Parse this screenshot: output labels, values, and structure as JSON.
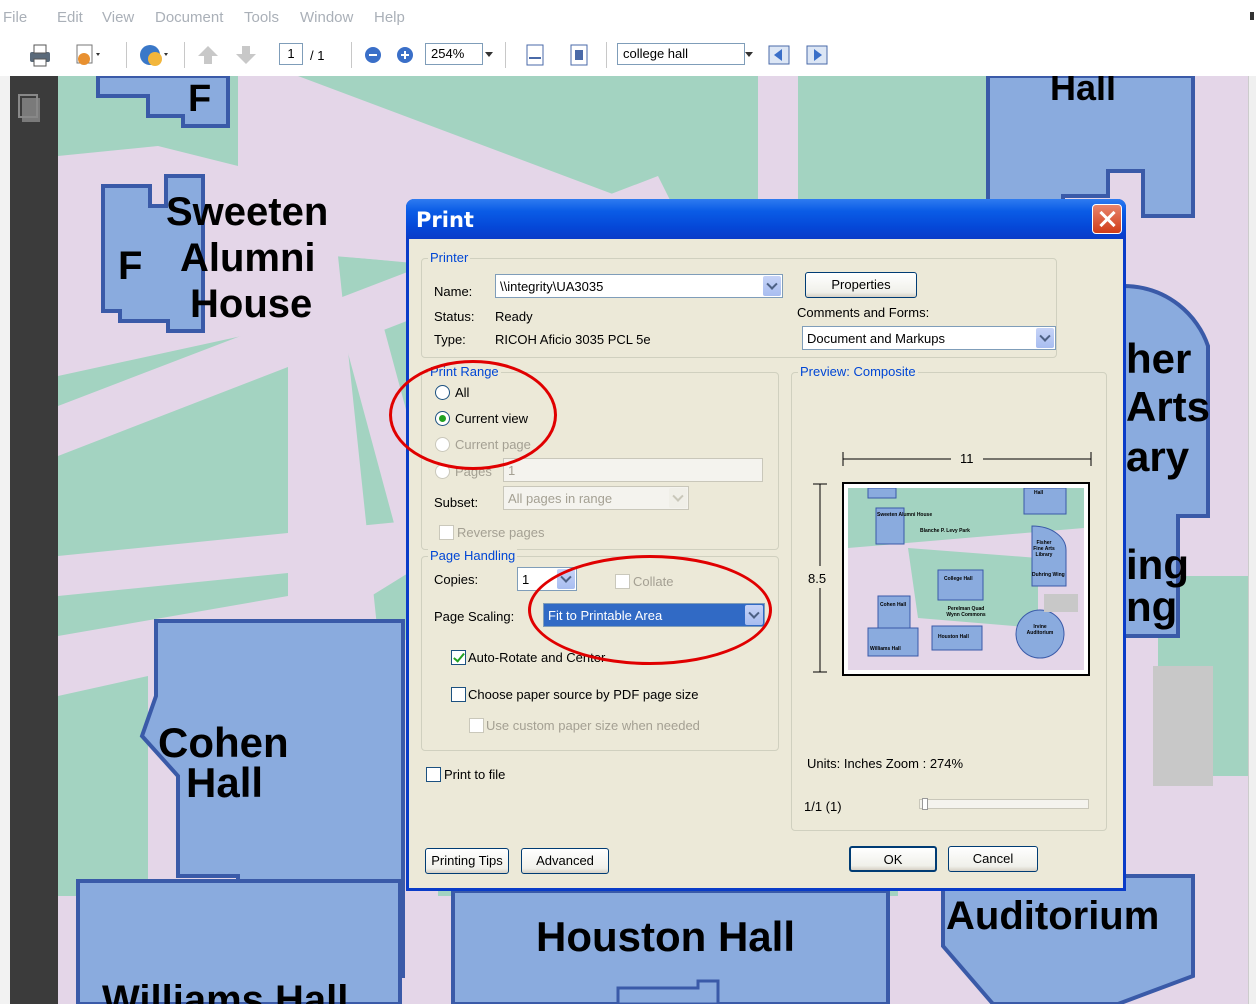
{
  "menu": [
    "File",
    "Edit",
    "View",
    "Document",
    "Tools",
    "Window",
    "Help"
  ],
  "toolbar": {
    "page_current": "1",
    "page_total": "/ 1",
    "zoom": "254%",
    "search": "college hall"
  },
  "map_labels": {
    "top_left_f": "F",
    "hall_top": "Hall",
    "sweeten_1": "Sweeten",
    "sweeten_2": "Alumni",
    "sweeten_3": "House",
    "f_left": "F",
    "fisher_1": "her",
    "fisher_2": "Arts",
    "fisher_3": "ary",
    "dulring_1": "ing",
    "dulring_2": "ng",
    "cohen_1": "Cohen",
    "cohen_2": "Hall",
    "houston": "Houston Hall",
    "auditorium": "Auditorium",
    "williams": "Williams Hall"
  },
  "dialog": {
    "title": "Print",
    "printer": {
      "group_label": "Printer",
      "name_label": "Name:",
      "name_value": "\\\\integrity\\UA3035",
      "status_label": "Status:",
      "status_value": "Ready",
      "type_label": "Type:",
      "type_value": "RICOH Aficio 3035 PCL 5e",
      "properties_button": "Properties",
      "comments_label": "Comments and Forms:",
      "comments_value": "Document and Markups"
    },
    "print_range": {
      "group_label": "Print Range",
      "all": "All",
      "current_view": "Current view",
      "current_page": "Current page",
      "pages": "Pages",
      "pages_value": "1",
      "subset_label": "Subset:",
      "subset_value": "All pages in range",
      "reverse": "Reverse pages"
    },
    "page_handling": {
      "group_label": "Page Handling",
      "copies_label": "Copies:",
      "copies_value": "1",
      "collate": "Collate",
      "scaling_label": "Page Scaling:",
      "scaling_value": "Fit to Printable Area",
      "auto_rotate": "Auto-Rotate and Center",
      "paper_source": "Choose paper source by PDF page size",
      "custom_paper": "Use custom paper size when needed"
    },
    "print_to_file": "Print to file",
    "preview": {
      "group_label": "Preview: Composite",
      "width": "11",
      "height": "8.5",
      "units_zoom": "Units: Inches Zoom : 274%",
      "page_counter": "1/1 (1)",
      "thumb_labels": [
        "Sweeten Alumni House",
        "Blanche P. Levy Park",
        "Fisher Fine Arts Library",
        "College Hall",
        "Duhring Wing",
        "Cohen Hall",
        "Perelman Quad Wynn Commons",
        "Houston Hall",
        "Irvine Auditorium",
        "Williams Hall",
        "Hall"
      ]
    },
    "buttons": {
      "printing_tips": "Printing Tips",
      "advanced": "Advanced",
      "ok": "OK",
      "cancel": "Cancel"
    }
  },
  "colors": {
    "map_path": "#e4d6e8",
    "map_green": "#a3d3c1",
    "map_building": "#8aabde",
    "map_building_border": "#3a5aa8",
    "dialog_title": "#0548d8",
    "annotation_red": "#e00000"
  }
}
